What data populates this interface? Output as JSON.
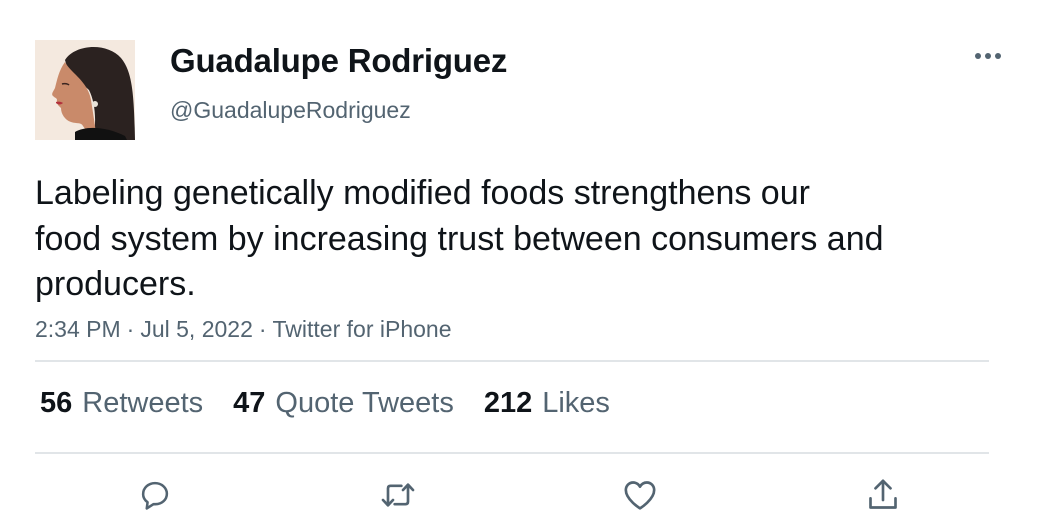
{
  "author": {
    "display_name": "Guadalupe Rodriguez",
    "handle": "@GuadalupeRodriguez",
    "avatar_icon": "profile-photo"
  },
  "tweet": {
    "text_lines": [
      "Labeling genetically modified foods strengthens our",
      "food system by increasing trust between consumers and",
      "producers."
    ],
    "time": "2:34 PM",
    "date": "Jul 5, 2022",
    "source": "Twitter for iPhone",
    "separator": "·"
  },
  "stats": {
    "retweets": {
      "count": "56",
      "label": "Retweets"
    },
    "quote_tweets": {
      "count": "47",
      "label": "Quote Tweets"
    },
    "likes": {
      "count": "212",
      "label": "Likes"
    }
  },
  "actions": [
    {
      "icon": "reply-icon"
    },
    {
      "icon": "retweet-icon"
    },
    {
      "icon": "like-icon"
    },
    {
      "icon": "share-icon"
    }
  ],
  "colors": {
    "text": "#0f1419",
    "secondary": "#536471",
    "divider": "#e1e5e8"
  }
}
